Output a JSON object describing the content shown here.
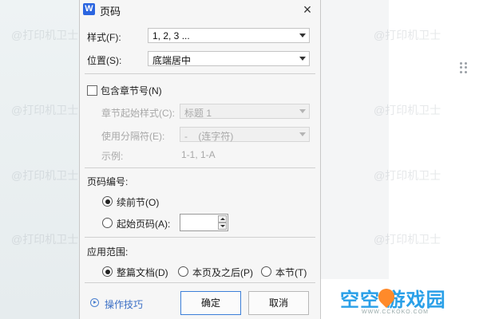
{
  "dialog": {
    "app_icon": "W",
    "title": "页码",
    "close_icon": "×"
  },
  "style_field": {
    "label": "样式(F):",
    "value": "1, 2, 3 ..."
  },
  "position_field": {
    "label": "位置(S):",
    "value": "底端居中"
  },
  "chapter": {
    "checkbox_label": "包含章节号(N)",
    "start_style_label": "章节起始样式(C):",
    "start_style_value": "标题 1",
    "separator_label": "使用分隔符(E):",
    "separator_value": "-    (连字符)",
    "example_label": "示例:",
    "example_value": "1-1, 1-A"
  },
  "numbering": {
    "section_label": "页码编号:",
    "continue_label": "续前节(O)",
    "start_at_label": "起始页码(A):",
    "start_at_value": ""
  },
  "apply_scope": {
    "section_label": "应用范围:",
    "whole_doc": "整篇文档(D)",
    "this_and_after": "本页及之后(P)",
    "this_section": "本节(T)"
  },
  "footer": {
    "tips_link": "操作技巧",
    "ok_button": "确定",
    "cancel_button": "取消"
  },
  "watermark_text": "@打印机卫士",
  "site_logo": {
    "text": "空空 游戏园",
    "url": "WWW.CCKOKO.COM"
  },
  "colors": {
    "accent": "#3c7fd8",
    "link": "#3b6fc5",
    "logo": "#2aa0e8",
    "logo_heart": "#ff8a2a"
  }
}
